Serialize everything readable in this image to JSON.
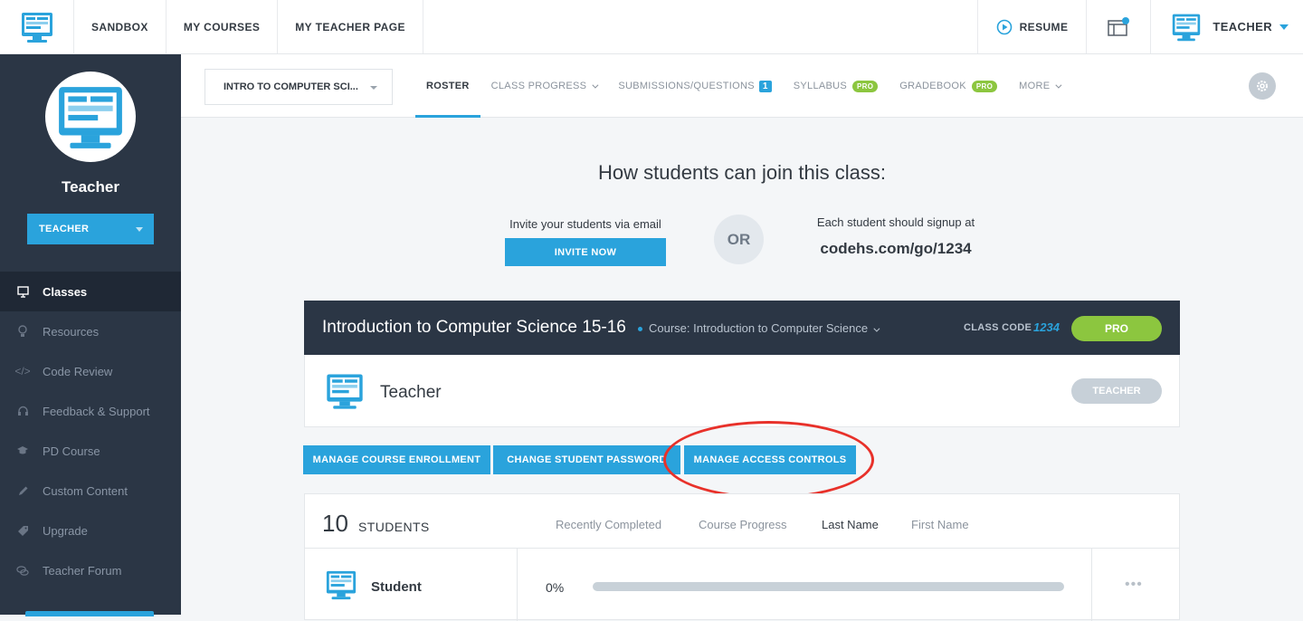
{
  "topnav": {
    "items": [
      "SANDBOX",
      "MY COURSES",
      "MY TEACHER PAGE"
    ],
    "resume": "RESUME",
    "user": "TEACHER"
  },
  "sidebar": {
    "name": "Teacher",
    "role": "TEACHER",
    "items": [
      {
        "label": "Classes",
        "icon": "monitor-icon"
      },
      {
        "label": "Resources",
        "icon": "lightbulb-icon"
      },
      {
        "label": "Code Review",
        "icon": "code-icon"
      },
      {
        "label": "Feedback & Support",
        "icon": "headset-icon"
      },
      {
        "label": "PD Course",
        "icon": "graduation-cap-icon"
      },
      {
        "label": "Custom Content",
        "icon": "pencil-icon"
      },
      {
        "label": "Upgrade",
        "icon": "tag-icon"
      },
      {
        "label": "Teacher Forum",
        "icon": "chat-icon"
      }
    ]
  },
  "subnav": {
    "class_select": "INTRO TO COMPUTER SCI...",
    "tabs": {
      "roster": "ROSTER",
      "progress": "CLASS PROGRESS",
      "submissions": "SUBMISSIONS/QUESTIONS",
      "submissions_count": "1",
      "syllabus": "SYLLABUS",
      "gradebook": "GRADEBOOK",
      "more": "MORE",
      "pro": "PRO"
    }
  },
  "join": {
    "title": "How students can join this class:",
    "invite_label": "Invite your students via email",
    "invite_button": "INVITE NOW",
    "or": "OR",
    "signup_label": "Each student should signup at",
    "signup_url": "codehs.com/go/1234"
  },
  "class": {
    "name": "Introduction to Computer Science 15-16",
    "course": "Course: Introduction to Computer Science",
    "code_label": "CLASS CODE",
    "code": "1234",
    "plan": "PRO",
    "teacher_name": "Teacher",
    "teacher_role": "TEACHER"
  },
  "actions": {
    "enrollment": "MANAGE COURSE ENROLLMENT",
    "password": "CHANGE STUDENT PASSWORD",
    "access": "MANAGE ACCESS CONTROLS"
  },
  "roster": {
    "count": "10",
    "count_label": "STUDENTS",
    "sort": [
      "Recently Completed",
      "Course Progress",
      "Last Name",
      "First Name"
    ],
    "active_sort": "Last Name",
    "students": [
      {
        "name": "Student",
        "progress_label": "0%",
        "progress": 0
      }
    ]
  },
  "colors": {
    "accent": "#2aa3dc",
    "sidebar": "#2b3645",
    "pro_green": "#8cc63f",
    "highlight": "#e8312a"
  }
}
